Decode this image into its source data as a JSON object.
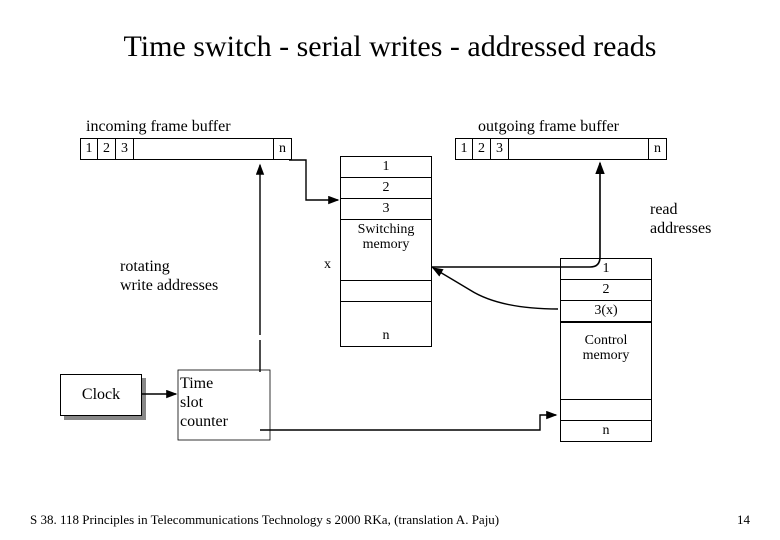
{
  "title": "Time switch - serial writes - addressed reads",
  "incoming": {
    "caption": "incoming frame buffer",
    "cells": [
      "1",
      "2",
      "3",
      "",
      "n"
    ]
  },
  "outgoing": {
    "caption": "outgoing frame buffer",
    "cells": [
      "1",
      "2",
      "3",
      "",
      "n"
    ]
  },
  "switching_memory": {
    "top_cells": [
      "1",
      "2",
      "3"
    ],
    "label": "Switching\nmemory",
    "marker": "x",
    "bottom_cell": "n"
  },
  "control_memory": {
    "cells": [
      "1",
      "2",
      "3(x)"
    ],
    "label": "Control\nmemory",
    "bottom_cell": "n"
  },
  "labels": {
    "rotating": "rotating\nwrite addresses",
    "read_addresses": "read\naddresses",
    "clock": "Clock",
    "tsc": "Time\nslot\ncounter"
  },
  "footer": "S 38. 118 Principles in Telecommunications Technology s 2000 RKa,  (translation A. Paju)",
  "page": "14"
}
